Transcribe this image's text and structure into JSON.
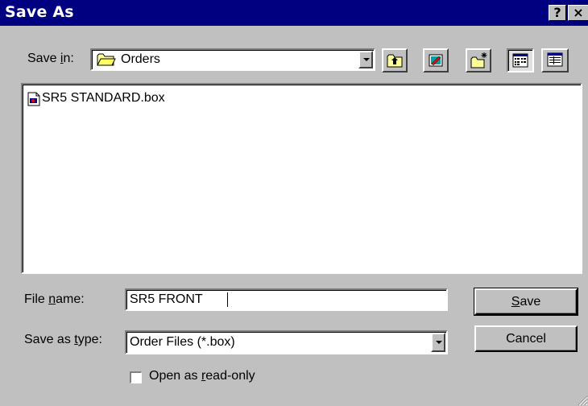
{
  "window": {
    "title": "Save As",
    "help_button": "?",
    "close_button": "×"
  },
  "save_in": {
    "label_pre": "Save ",
    "label_underlined": "i",
    "label_post": "n:",
    "folder": "Orders"
  },
  "files": [
    {
      "name": "SR5 STANDARD.box",
      "icon": "document-icon"
    }
  ],
  "file_name": {
    "label_pre": "File ",
    "label_underlined": "n",
    "label_post": "ame:",
    "value": "SR5 FRONT"
  },
  "save_as_type": {
    "label_pre": "Save as ",
    "label_underlined": "t",
    "label_post": "ype:",
    "value": "Order Files (*.box)"
  },
  "buttons": {
    "save_underlined": "S",
    "save_rest": "ave",
    "cancel": "Cancel"
  },
  "read_only": {
    "label_pre": "Open as ",
    "label_underlined": "r",
    "label_post": "ead-only",
    "checked": false
  },
  "colors": {
    "title_bar": "#000080",
    "face": "#c0c0c0",
    "selection": "#000080"
  }
}
